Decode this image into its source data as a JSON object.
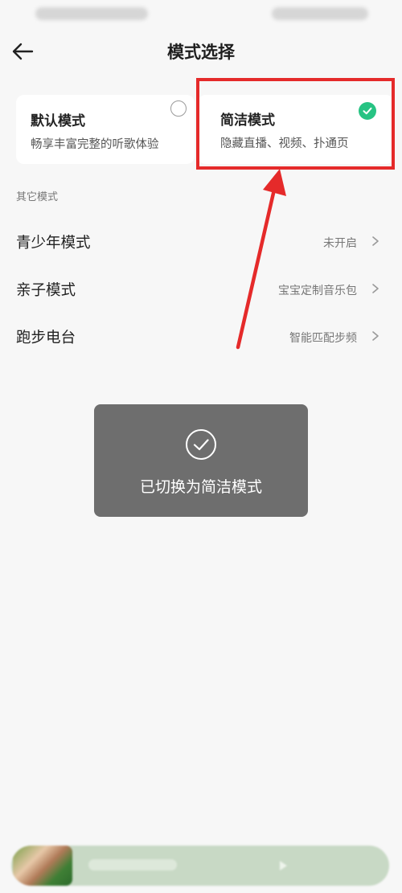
{
  "header": {
    "title": "模式选择",
    "back_icon": "arrow-left-icon"
  },
  "modes": [
    {
      "title": "默认模式",
      "desc": "畅享丰富完整的听歌体验",
      "selected": false
    },
    {
      "title": "简洁模式",
      "desc": "隐藏直播、视频、扑通页",
      "selected": true
    }
  ],
  "colors": {
    "accent_green": "#27c383",
    "annotation_red": "#e52a2a",
    "toast_bg": "#6e6e6e"
  },
  "other_section": {
    "label": "其它模式",
    "items": [
      {
        "label": "青少年模式",
        "value": "未开启"
      },
      {
        "label": "亲子模式",
        "value": "宝宝定制音乐包"
      },
      {
        "label": "跑步电台",
        "value": "智能匹配步频"
      }
    ]
  },
  "toast": {
    "icon": "check-circle-icon",
    "text": "已切换为简洁模式"
  },
  "mini_player": {
    "play_icon": "play-icon"
  }
}
